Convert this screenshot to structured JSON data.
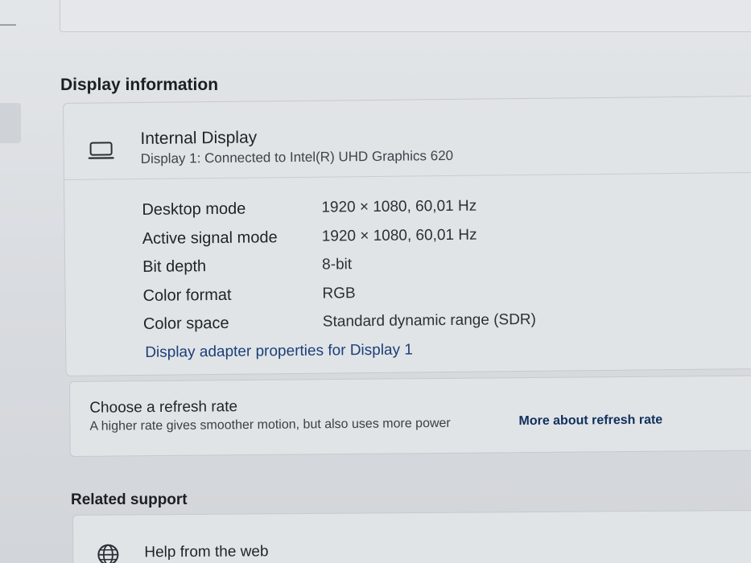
{
  "display_information": {
    "title": "Display information",
    "display_name": "Internal Display",
    "display_sub": "Display 1: Connected to Intel(R) UHD Graphics 620",
    "icon": "laptop-icon",
    "rows": [
      {
        "label": "Desktop mode",
        "value": "1920 × 1080, 60,01 Hz"
      },
      {
        "label": "Active signal mode",
        "value": "1920 × 1080, 60,01 Hz"
      },
      {
        "label": "Bit depth",
        "value": "8-bit"
      },
      {
        "label": "Color format",
        "value": "RGB"
      },
      {
        "label": "Color space",
        "value": "Standard dynamic range (SDR)"
      }
    ],
    "adapter_link": "Display adapter properties for Display 1"
  },
  "refresh": {
    "title": "Choose a refresh rate",
    "description": "A higher rate gives smoother motion, but also uses more power",
    "link": "More about refresh rate"
  },
  "related_support": {
    "title": "Related support",
    "help_label": "Help from the web",
    "icon": "globe-icon"
  },
  "colors": {
    "link": "#1a3f78",
    "background": "#dadde0",
    "card": "#e1e4e7"
  }
}
